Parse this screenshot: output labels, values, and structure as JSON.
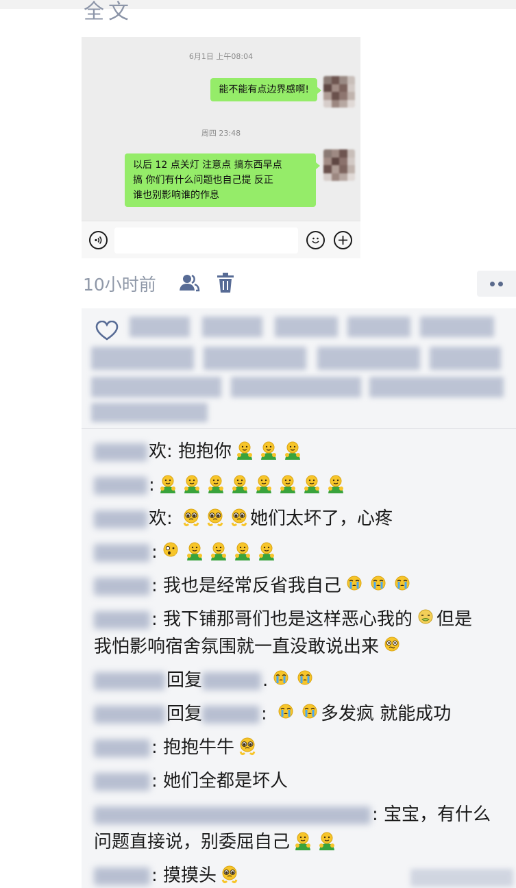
{
  "header": {
    "cut_title": "全文"
  },
  "chat_screenshot": {
    "timestamps": [
      "6月1日 上午08:04",
      "周四 23:48"
    ],
    "messages": [
      {
        "text": "能不能有点边界感啊!"
      },
      {
        "line1": "以后 12 点关灯 注意点 搞东西早点",
        "line2": "搞 你们有什么问题也自己提 反正",
        "line3": "谁也别影响谁的作息"
      }
    ],
    "input_bar": {
      "voice_icon": "voice-icon",
      "emoji_icon": "emoji-icon",
      "plus_icon": "plus-icon",
      "placeholder": ""
    }
  },
  "moment": {
    "time": "10小时前",
    "icons": [
      "people-icon",
      "trash-icon",
      "more-icon"
    ]
  },
  "comments": [
    {
      "text": "欢: 抱抱你",
      "emojis": [
        "hug",
        "hug",
        "hug"
      ]
    },
    {
      "text": ":",
      "emojis": [
        "hug",
        "hug",
        "hug",
        "hug",
        "hug",
        "hug",
        "hug",
        "hug"
      ]
    },
    {
      "text": "欢: ",
      "emojis": [
        "plead",
        "plead",
        "plead"
      ],
      "tail": "她们太坏了，心疼"
    },
    {
      "text": ":",
      "emojis": [
        "gasp",
        "hug",
        "hug",
        "hug",
        "hug"
      ]
    },
    {
      "text": ": 我也是经常反省我自己",
      "emojis": [
        "cry",
        "cry",
        "cry"
      ]
    },
    {
      "text": ": 我下铺那哥们也是这样恶心我的",
      "emoji_mid": "sick",
      "tail": "但是",
      "line2": "我怕影响宿舍氛围就一直没敢说出来",
      "emoji_end": "dizzy"
    },
    {
      "reply_word": "回复",
      "text": ".",
      "emojis": [
        "cry",
        "cry"
      ]
    },
    {
      "reply_word": "回复",
      "text": ": ",
      "emojis": [
        "cry",
        "cry"
      ],
      "tail": "多发疯 就能成功"
    },
    {
      "text": ": 抱抱牛牛",
      "emojis": [
        "plead"
      ]
    },
    {
      "text": ": 她们全都是坏人"
    },
    {
      "text": ": 宝宝，有什么",
      "line2": "问题直接说，别委屈自己",
      "emojis": [
        "hug",
        "hug"
      ]
    },
    {
      "text": ": 摸摸头",
      "emojis": [
        "plead"
      ]
    }
  ],
  "colors": {
    "bubble": "#95ec69",
    "chat_bg": "#ededed",
    "social_bg": "#f4f5f7",
    "meta": "#8f98a8",
    "link": "#576b95"
  }
}
